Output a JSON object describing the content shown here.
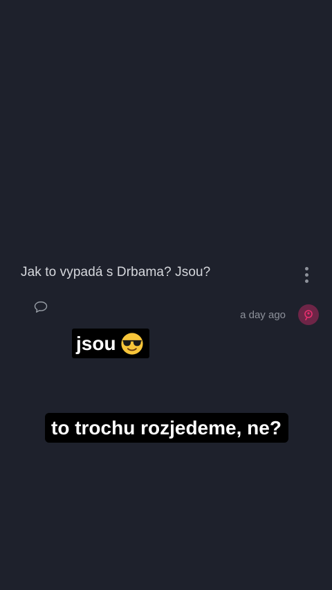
{
  "post": {
    "question": "Jak to vypadá s Drbama? Jsou?",
    "timestamp": "a day ago"
  },
  "stickers": {
    "first_text": "jsou",
    "first_emoji": "smiling-face-with-sunglasses",
    "second_text": "to trochu rozjedeme, ne?"
  },
  "icons": {
    "more": "more-vertical-icon",
    "comment": "comment-bubble-icon",
    "avatar": "avatar-icon"
  },
  "colors": {
    "background": "#1e212c",
    "avatar_bg": "#6e2547",
    "avatar_fg": "#e8306f",
    "sticker_bg": "#000000"
  }
}
